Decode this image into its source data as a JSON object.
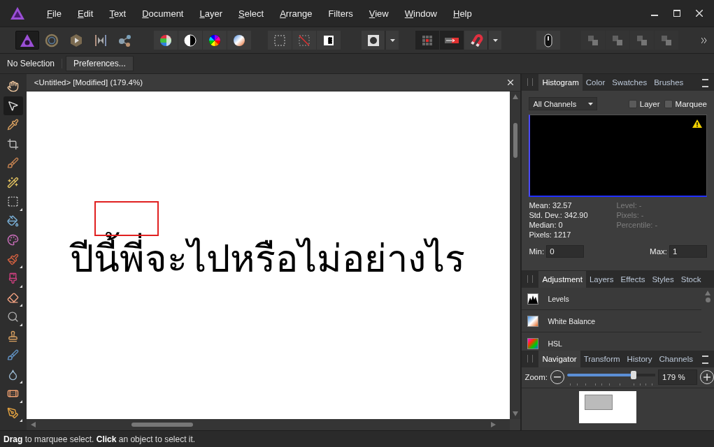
{
  "menu": [
    {
      "label": "File",
      "underline": true
    },
    {
      "label": "Edit",
      "underline": true
    },
    {
      "label": "Text",
      "underline": true
    },
    {
      "label": "Document",
      "underline": true
    },
    {
      "label": "Layer",
      "underline": true
    },
    {
      "label": "Select",
      "underline": true
    },
    {
      "label": "Arrange",
      "underline": true
    },
    {
      "label": "Filters",
      "underline": false
    },
    {
      "label": "View",
      "underline": true
    },
    {
      "label": "Window",
      "underline": true
    },
    {
      "label": "Help",
      "underline": true
    }
  ],
  "toolbar": {
    "groups": [
      {
        "dropdown": false,
        "buttons": [
          {
            "kind": "photo-persona",
            "selected": true
          },
          {
            "kind": "liquify-persona",
            "selected": false
          },
          {
            "kind": "develop-persona",
            "selected": false
          },
          {
            "kind": "tone-map-persona",
            "selected": false
          },
          {
            "kind": "export-persona",
            "selected": false
          }
        ]
      },
      {
        "dropdown": false,
        "buttons": [
          {
            "kind": "levels"
          },
          {
            "kind": "contrast"
          },
          {
            "kind": "color-wheel"
          },
          {
            "kind": "gradient-ball"
          }
        ]
      },
      {
        "dropdown": false,
        "buttons": [
          {
            "kind": "marquee"
          },
          {
            "kind": "deselect"
          },
          {
            "kind": "invert"
          }
        ]
      },
      {
        "dropdown": true,
        "buttons": [
          {
            "kind": "mask"
          }
        ]
      },
      {
        "dropdown": true,
        "buttons": [
          {
            "kind": "grid-snap",
            "on": true
          },
          {
            "kind": "arrow-snap",
            "on": true
          },
          {
            "kind": "magnet",
            "on": false
          }
        ]
      },
      {
        "dropdown": false,
        "buttons": [
          {
            "kind": "mouse"
          }
        ]
      },
      {
        "dropdown": false,
        "buttons": [
          {
            "kind": "arrange",
            "disabled": true
          },
          {
            "kind": "arrange",
            "disabled": true
          },
          {
            "kind": "arrange",
            "disabled": true
          },
          {
            "kind": "arrange",
            "disabled": true
          }
        ]
      }
    ]
  },
  "context_bar": {
    "status": "No Selection",
    "button": "Preferences..."
  },
  "tools": [
    {
      "kind": "hand",
      "selected": false,
      "flyout": false
    },
    {
      "kind": "pointer",
      "selected": true,
      "flyout": false
    },
    {
      "kind": "eyedropper",
      "selected": false,
      "flyout": false
    },
    {
      "kind": "crop",
      "selected": false,
      "flyout": false
    },
    {
      "kind": "selection-brush",
      "selected": false,
      "flyout": false
    },
    {
      "kind": "wand",
      "selected": false,
      "flyout": false
    },
    {
      "kind": "marquee",
      "selected": false,
      "flyout": true
    },
    {
      "kind": "bucket",
      "selected": false,
      "flyout": false
    },
    {
      "kind": "palette",
      "selected": false,
      "flyout": false
    },
    {
      "kind": "paintbrush",
      "selected": false,
      "flyout": true
    },
    {
      "kind": "color-brush",
      "selected": false,
      "flyout": true
    },
    {
      "kind": "eraser",
      "selected": false,
      "flyout": true
    },
    {
      "kind": "magnifier",
      "selected": false,
      "flyout": true
    },
    {
      "kind": "stamp",
      "selected": false,
      "flyout": false
    },
    {
      "kind": "undo-brush",
      "selected": false,
      "flyout": false
    },
    {
      "kind": "droplet",
      "selected": false,
      "flyout": true
    },
    {
      "kind": "bandage",
      "selected": false,
      "flyout": true
    },
    {
      "kind": "pen",
      "selected": false,
      "flyout": true
    }
  ],
  "document": {
    "title": "<Untitled> [Modified] (179.4%)",
    "canvas_text": "ปีนี้พี่จะไปหรือไม่อย่างไร"
  },
  "histogram_panel": {
    "tabs": [
      {
        "label": "Histogram",
        "selected": true
      },
      {
        "label": "Color",
        "selected": false
      },
      {
        "label": "Swatches",
        "selected": false
      },
      {
        "label": "Brushes",
        "selected": false
      }
    ],
    "channel": "All Channels",
    "checkboxes": [
      {
        "label": "Layer",
        "checked": false
      },
      {
        "label": "Marquee",
        "checked": false
      }
    ],
    "stats": [
      {
        "label": "Mean: 32.57",
        "disabled": false
      },
      {
        "label": "Std. Dev.: 342.90",
        "disabled": false
      },
      {
        "label": "Median: 0",
        "disabled": false
      },
      {
        "label": "Pixels: 1217",
        "disabled": false
      }
    ],
    "cursor_stats": [
      {
        "label": "Level: -",
        "disabled": true
      },
      {
        "label": "Pixels: -",
        "disabled": true
      },
      {
        "label": "Percentile: -",
        "disabled": true
      }
    ],
    "min": {
      "label": "Min:",
      "value": "0"
    },
    "max": {
      "label": "Max:",
      "value": "1"
    }
  },
  "adjustment_panel": {
    "tabs": [
      {
        "label": "Adjustment",
        "selected": true
      },
      {
        "label": "Layers",
        "selected": false
      },
      {
        "label": "Effects",
        "selected": false
      },
      {
        "label": "Styles",
        "selected": false
      },
      {
        "label": "Stock",
        "selected": false
      }
    ],
    "items": [
      {
        "kind": "levels",
        "label": "Levels"
      },
      {
        "kind": "white-balance",
        "label": "White Balance"
      },
      {
        "kind": "hsl",
        "label": "HSL"
      }
    ]
  },
  "navigator_panel": {
    "tabs": [
      {
        "label": "Navigator",
        "selected": true
      },
      {
        "label": "Transform",
        "selected": false
      },
      {
        "label": "History",
        "selected": false
      },
      {
        "label": "Channels",
        "selected": false
      }
    ],
    "zoom_label": "Zoom:",
    "zoom": {
      "level": 0.75
    },
    "zoom_value": "179 %"
  },
  "status_bar": "**Drag** to marquee select. **Click** an object to select it."
}
